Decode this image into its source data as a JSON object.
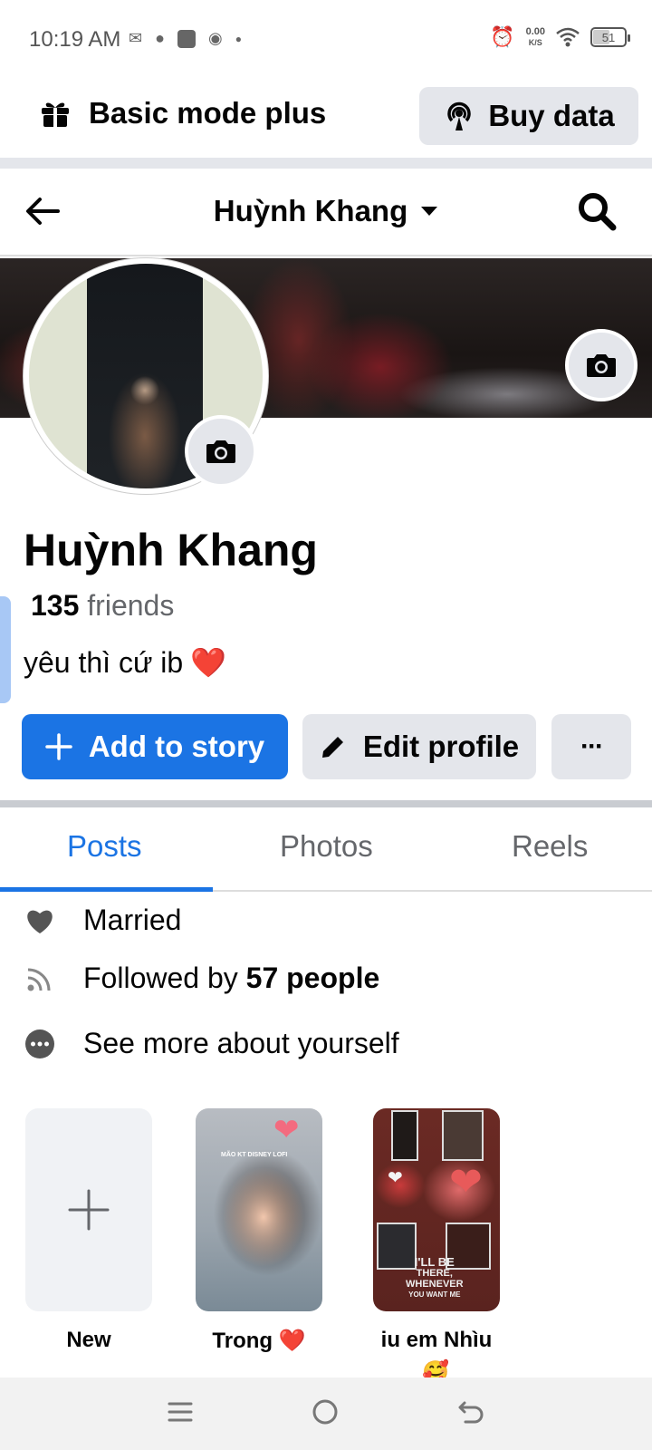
{
  "status_bar": {
    "time": "10:19 AM",
    "net_speed_value": "0.00",
    "net_speed_unit": "K/S",
    "battery_level": "51"
  },
  "banner": {
    "basic_mode_label": "Basic mode plus",
    "buy_data_label": "Buy data"
  },
  "nav": {
    "title": "Huỳnh Khang"
  },
  "profile": {
    "name": "Huỳnh Khang",
    "friends_count": "135",
    "friends_label": "friends",
    "bio": "yêu thì cứ ib",
    "bio_emoji": "❤️"
  },
  "actions": {
    "add_story": "Add to story",
    "edit_profile": "Edit profile",
    "more": "···"
  },
  "tabs": [
    {
      "label": "Posts"
    },
    {
      "label": "Photos"
    },
    {
      "label": "Reels"
    }
  ],
  "details": {
    "relationship": "Married",
    "followed_prefix": "Followed by",
    "followed_count": "57 people",
    "see_more": "See more about yourself"
  },
  "highlights": [
    {
      "label": "New"
    },
    {
      "label": "Trong ❤️"
    },
    {
      "label": "iu em Nhìu"
    }
  ],
  "highlight_captions": {
    "trong_overlay": "MÃO KT DISNEY LOFI",
    "iu_overlay_1": "I'LL BE",
    "iu_overlay_2": "THERE,",
    "iu_overlay_3": "WHENEVER",
    "iu_overlay_4": "YOU WANT ME"
  },
  "colors": {
    "accent": "#1b74e4",
    "button_gray": "#e4e6eb",
    "secondary_text": "#65676b"
  }
}
